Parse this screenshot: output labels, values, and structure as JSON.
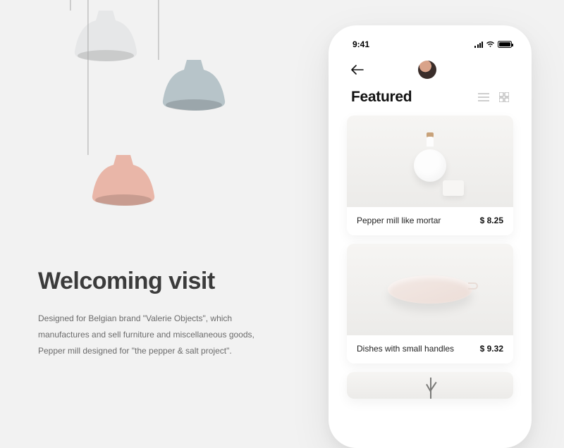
{
  "hero": {
    "heading": "Welcoming visit",
    "body": "Designed for Belgian brand \"Valerie Objects\", which manufactures and sell furniture and miscellaneous goods, Pepper mill designed for \"the pepper & salt project\"."
  },
  "status": {
    "time": "9:41"
  },
  "section_title": "Featured",
  "products": [
    {
      "name": "Pepper mill like mortar",
      "price": "$ 8.25"
    },
    {
      "name": "Dishes with small handles",
      "price": "$ 9.32"
    }
  ]
}
